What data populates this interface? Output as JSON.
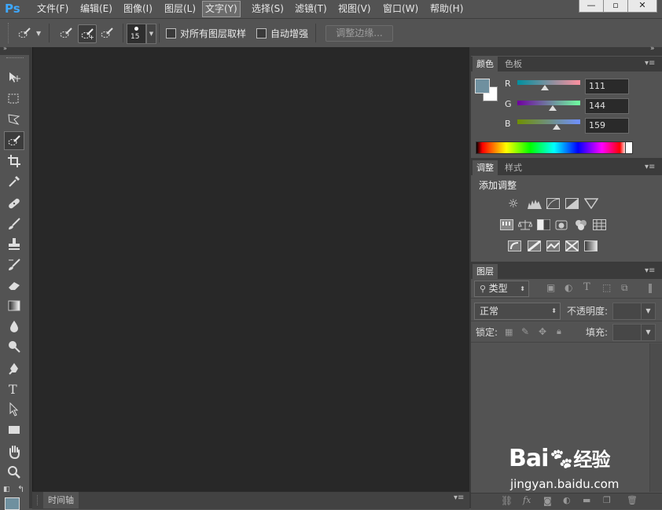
{
  "app": {
    "logo": "Ps"
  },
  "menu": [
    "文件(F)",
    "编辑(E)",
    "图像(I)",
    "图层(L)",
    "文字(Y)",
    "选择(S)",
    "滤镜(T)",
    "视图(V)",
    "窗口(W)",
    "帮助(H)"
  ],
  "menu_active": "文字(Y)",
  "window_controls": {
    "minimize": "—",
    "restore": "▫",
    "close": "✕"
  },
  "options": {
    "brush_size": "15",
    "sample_all_layers": "对所有图层取样",
    "auto_enhance": "自动增强",
    "refine_edge": "调整边缘..."
  },
  "color_panel": {
    "tabs": [
      "颜色",
      "色板"
    ],
    "channels": [
      {
        "label": "R",
        "value": "111",
        "fraction": 0.435
      },
      {
        "label": "G",
        "value": "144",
        "fraction": 0.565
      },
      {
        "label": "B",
        "value": "159",
        "fraction": 0.624
      }
    ],
    "foreground": "#6f909f",
    "background": "#ffffff"
  },
  "adjust_panel": {
    "tabs": [
      "调整",
      "样式"
    ],
    "title": "添加调整"
  },
  "layers_panel": {
    "tab": "图层",
    "filter": "类型",
    "blend_mode": "正常",
    "opacity_label": "不透明度:",
    "lock_label": "锁定:",
    "fill_label": "填充:"
  },
  "timeline": {
    "label": "时间轴"
  },
  "watermark": {
    "site": "jingyan.baidu.com",
    "brand_a": "Bai",
    "brand_b": "经验"
  }
}
